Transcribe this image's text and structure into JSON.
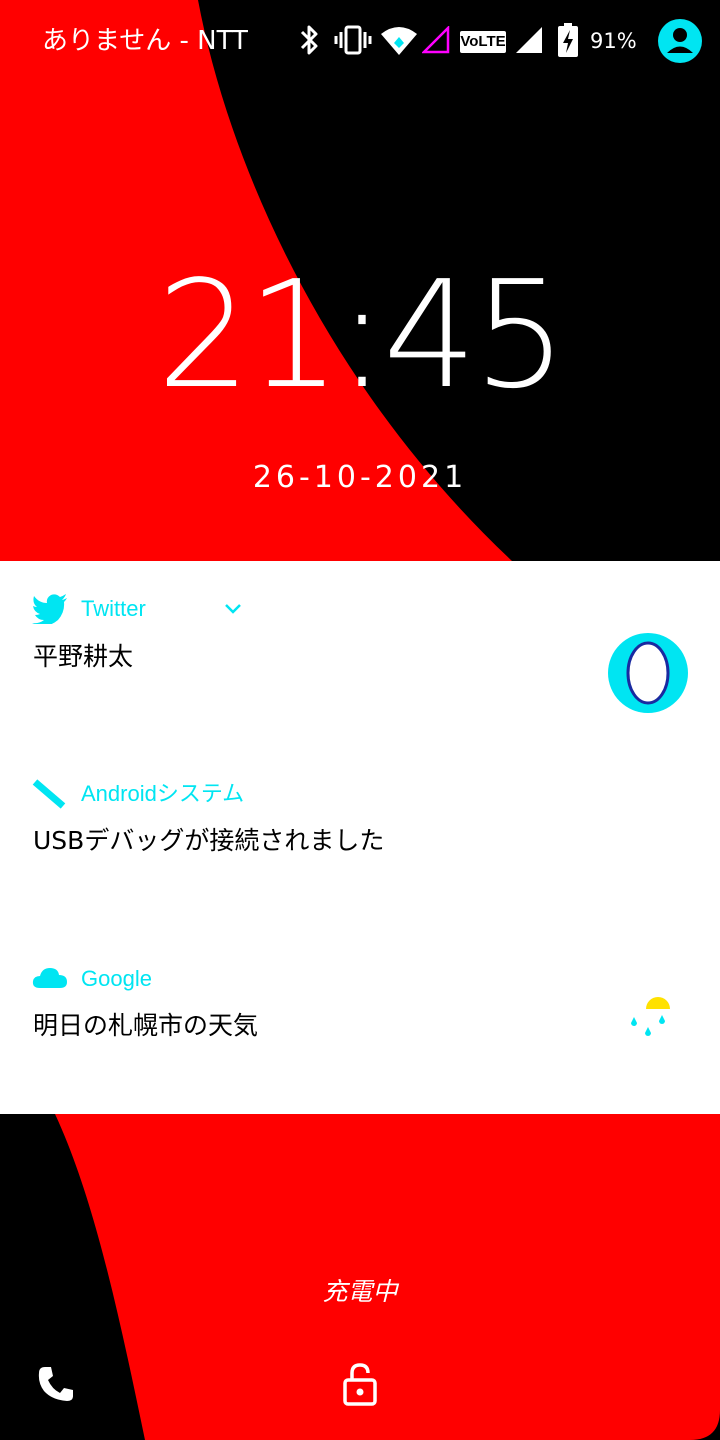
{
  "colors": {
    "wallpaper_red": "#ff0000",
    "wallpaper_black": "#000000",
    "accent": "#00e5f2",
    "card": "#ffffff"
  },
  "status_bar": {
    "carrier": "ありません - NTT",
    "battery_percent": "91%",
    "icons": [
      "bluetooth-icon",
      "vibrate-icon",
      "wifi-icon",
      "mobile-data-signal-icon",
      "volte-icon",
      "cell-signal-icon",
      "battery-charging-icon",
      "user-avatar-icon"
    ],
    "volte_label": "VoLTE"
  },
  "lockscreen": {
    "time": "21:45",
    "date": "26-10-2021",
    "charging_text": "充電中"
  },
  "notifications": [
    {
      "app": "Twitter",
      "text": "平野耕太",
      "icon": "twitter-bird-icon",
      "expand_icon": "chevron-down-icon"
    },
    {
      "app": "Androidシステム",
      "text": "USBデバッグが接続されました",
      "icon": "usb-debug-icon"
    },
    {
      "app": "Google",
      "text": "明日の札幌市の天気",
      "icon": "cloud-icon",
      "thumbnail": "rain-weather-icon"
    }
  ],
  "bottom_bar": {
    "left": "phone-icon",
    "center": "lock-open-icon"
  }
}
